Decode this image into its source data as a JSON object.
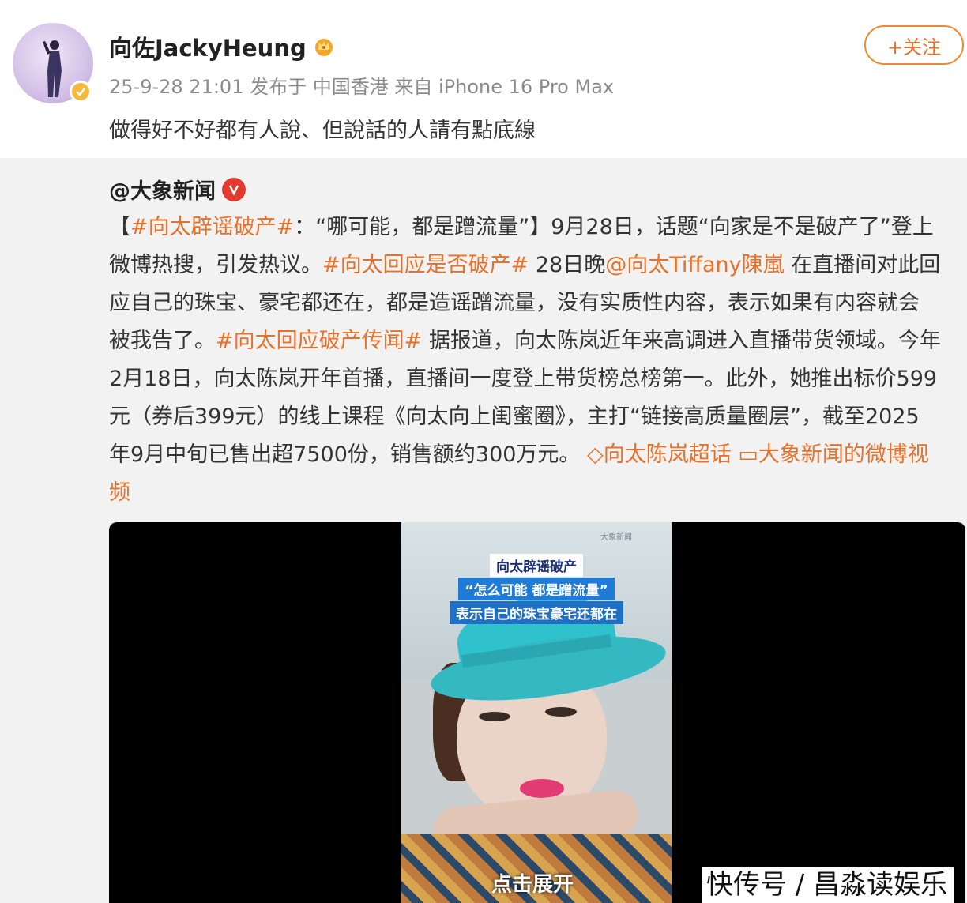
{
  "post": {
    "username": "向佐JackyHeung",
    "meta": "25-9-28 21:01 发布于 中国香港 来自 iPhone 16 Pro Max",
    "follow_label": "+关注",
    "text": "做得好不好都有人說、但說話的人請有點底線"
  },
  "repost": {
    "author": "@大象新闻",
    "lines": [
      [
        {
          "t": "【",
          "c": ""
        },
        {
          "t": "#向太辟谣破产#",
          "c": "orange"
        },
        {
          "t": "：“哪可能，都是蹭流量”】9月28日，话题“向家是不是破产了”登上",
          "c": ""
        }
      ],
      [
        {
          "t": "微博热搜，引发热议。",
          "c": ""
        },
        {
          "t": "#向太回应是否破产#",
          "c": "orange"
        },
        {
          "t": " 28日晚",
          "c": ""
        },
        {
          "t": "@向太Tiffany陳嵐",
          "c": "orange"
        },
        {
          "t": " 在直播间对此回",
          "c": ""
        }
      ],
      [
        {
          "t": "应自己的珠宝、豪宅都还在，都是造谣蹭流量，没有实质性内容，表示如果有内容就会",
          "c": ""
        }
      ],
      [
        {
          "t": "被我告了。",
          "c": ""
        },
        {
          "t": "#向太回应破产传闻#",
          "c": "orange"
        },
        {
          "t": " 据报道，向太陈岚近年来高调进入直播带货领域。今年",
          "c": ""
        }
      ],
      [
        {
          "t": "2月18日，向太陈岚开年首播，直播间一度登上带货榜总榜第一。此外，她推出标价599",
          "c": ""
        }
      ],
      [
        {
          "t": "元（券后399元）的线上课程《向太向上闺蜜圈》，主打“链接高质量圈层”，截至2025",
          "c": ""
        }
      ],
      [
        {
          "t": "年9月中旬已售出超7500份，销售额约300万元。",
          "c": ""
        },
        {
          "t": " ◇向太陈岚超话",
          "c": "orange"
        },
        {
          "t": " ▭大象新闻的微博视",
          "c": "orange"
        }
      ],
      [
        {
          "t": "频",
          "c": "orange"
        }
      ]
    ]
  },
  "video": {
    "caption_title": "向太辟谣破产",
    "caption_quote": "“怎么可能 都是蹭流量”",
    "caption_sub": "表示自己的珠宝豪宅还都在",
    "expand_label": "点击展开",
    "logo_text": "大象新闻"
  },
  "watermark": "快传号 / 昌淼读娱乐",
  "colors": {
    "accent_orange": "#e8712a",
    "verified_gold": "#f6b93b",
    "red_v": "#e23a2e"
  },
  "icons": [
    "verified-icon",
    "crown-icon",
    "red-v-icon",
    "supertopic-icon",
    "video-link-icon"
  ]
}
